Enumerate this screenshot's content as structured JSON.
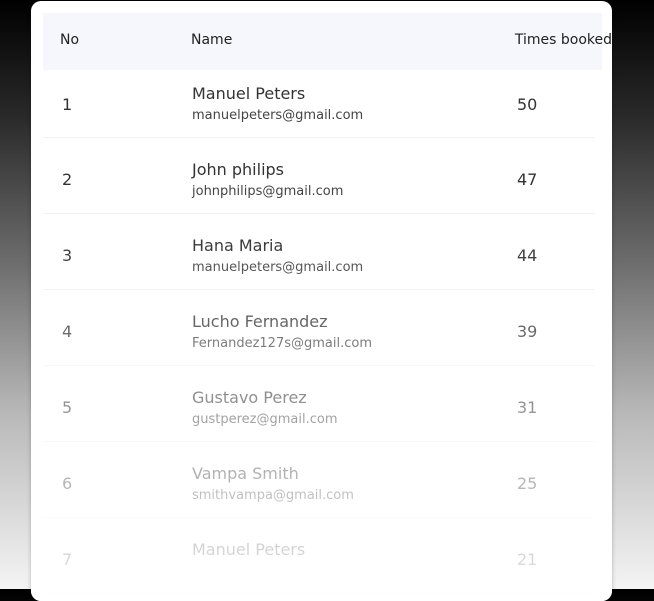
{
  "table": {
    "headers": {
      "no": "No",
      "name": "Name",
      "times_booked": "Times booked"
    },
    "rows": [
      {
        "no": "1",
        "name": "Manuel Peters",
        "email": "manuelpeters@gmail.com",
        "times": "50"
      },
      {
        "no": "2",
        "name": "John philips",
        "email": "johnphilips@gmail.com",
        "times": "47"
      },
      {
        "no": "3",
        "name": "Hana Maria",
        "email": "manuelpeters@gmail.com",
        "times": "44"
      },
      {
        "no": "4",
        "name": "Lucho Fernandez",
        "email": "Fernandez127s@gmail.com",
        "times": "39"
      },
      {
        "no": "5",
        "name": "Gustavo Perez",
        "email": "gustperez@gmail.com",
        "times": "31"
      },
      {
        "no": "6",
        "name": "Vampa Smith",
        "email": "smithvampa@gmail.com",
        "times": "25"
      },
      {
        "no": "7",
        "name": "Manuel Peters",
        "email": "",
        "times": "21"
      }
    ]
  }
}
